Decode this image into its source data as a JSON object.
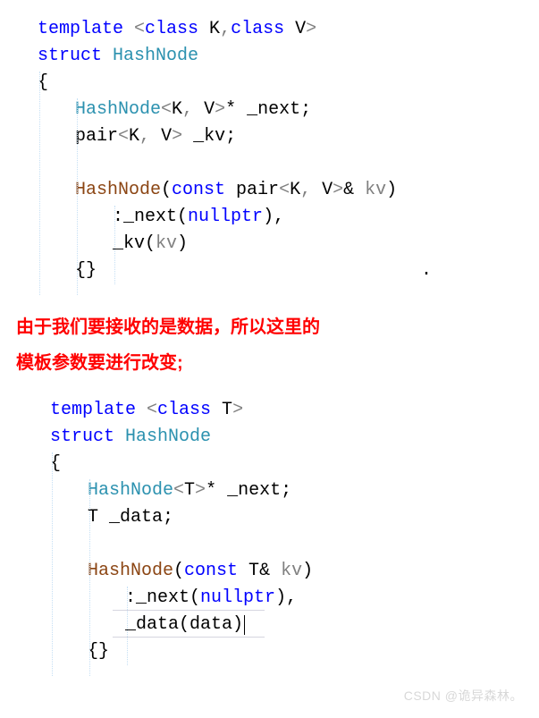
{
  "code1": {
    "l1": {
      "template": "template",
      "open": " <",
      "class1": "class",
      "K": " K",
      "comma": ",",
      "class2": "class",
      "V": " V",
      "close": ">"
    },
    "l2": {
      "struct": "struct",
      "name": " HashNode"
    },
    "l3": {
      "brace": "{"
    },
    "l4": {
      "name": "HashNode",
      "open": "<",
      "K": "K",
      "comma": ", ",
      "V": "V",
      "close": ">",
      "star": "*",
      "member": " _next",
      "semi": ";"
    },
    "l5": {
      "name": "pair",
      "open": "<",
      "K": "K",
      "comma": ", ",
      "V": "V",
      "close": ">",
      "member": " _kv",
      "semi": ";"
    },
    "l7": {
      "name": "HashNode",
      "lparen": "(",
      "const": "const",
      "pair": " pair",
      "open": "<",
      "K": "K",
      "comma": ", ",
      "V": "V",
      "close": ">",
      "amp": "&",
      "param": " kv",
      "rparen": ")"
    },
    "l8": {
      "colon": ":",
      "member": "_next",
      "lparen": "(",
      "null": "nullptr",
      "rparen": ")",
      "comma": ","
    },
    "l9": {
      "member": "_kv",
      "lparen": "(",
      "param": "kv",
      "rparen": ")"
    },
    "l10": {
      "braces": "{}"
    },
    "dot": "."
  },
  "comment": {
    "line1": "由于我们要接收的是数据，所以这里的",
    "line2": "模板参数要进行改变;"
  },
  "code2": {
    "l1": {
      "template": "template",
      "open": " <",
      "class1": "class",
      "T": " T",
      "close": ">"
    },
    "l2": {
      "struct": "struct",
      "name": " HashNode"
    },
    "l3": {
      "brace": "{"
    },
    "l4": {
      "name": "HashNode",
      "open": "<",
      "T": "T",
      "close": ">",
      "star": "*",
      "member": " _next",
      "semi": ";"
    },
    "l5": {
      "T": "T",
      "member": " _data",
      "semi": ";"
    },
    "l7": {
      "name": "HashNode",
      "lparen": "(",
      "const": "const",
      "T": " T",
      "amp": "&",
      "param": " kv",
      "rparen": ")"
    },
    "l8": {
      "colon": ":",
      "member": "_next",
      "lparen": "(",
      "null": "nullptr",
      "rparen": ")",
      "comma": ","
    },
    "l9": {
      "member": "_data",
      "lparen": "(",
      "param": "data",
      "rparen": ")"
    },
    "l10": {
      "braces": "{}"
    }
  },
  "watermark": "CSDN @诡异森林。"
}
